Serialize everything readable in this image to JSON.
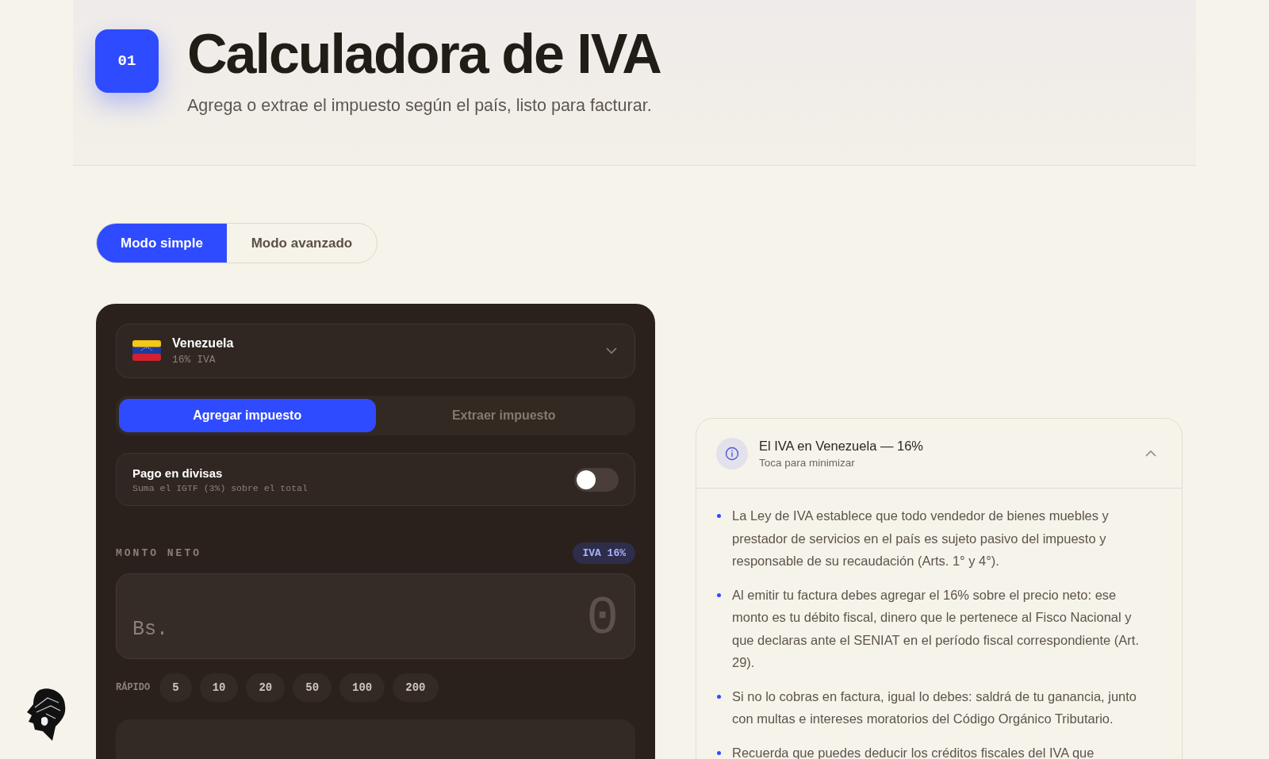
{
  "header": {
    "badge": "01",
    "title": "Calculadora de IVA",
    "subtitle": "Agrega o extrae el impuesto según el país, listo para facturar."
  },
  "modes": [
    {
      "label": "Modo simple",
      "selected": true
    },
    {
      "label": "Modo avanzado",
      "selected": false
    }
  ],
  "calculator": {
    "country": {
      "name": "Venezuela",
      "rate": "16% IVA",
      "expanded": false
    },
    "operations": [
      {
        "label": "Agregar impuesto",
        "selected": true
      },
      {
        "label": "Extraer impuesto",
        "selected": false
      }
    ],
    "currency_payment": {
      "title": "Pago en divisas",
      "description": "Suma el IGTF (3%) sobre el total",
      "on": false
    },
    "amount": {
      "label": "MONTO NETO",
      "badge": "IVA 16%",
      "currency": "Bs.",
      "placeholder": "0"
    },
    "quick": {
      "label": "RÁPIDO",
      "values": [
        "5",
        "10",
        "20",
        "50",
        "100",
        "200"
      ]
    }
  },
  "info": {
    "title": "El IVA en Venezuela — 16%",
    "hint": "Toca para minimizar",
    "expanded": true,
    "bullets": [
      "La Ley de IVA establece que todo vendedor de bienes muebles y prestador de servicios en el país es sujeto pasivo del impuesto y responsable de su recaudación (Arts. 1° y 4°).",
      "Al emitir tu factura debes agregar el 16% sobre el precio neto: ese monto es tu débito fiscal, dinero que le pertenece al Fisco Nacional y que declaras ante el SENIAT en el período fiscal correspondiente (Art. 29).",
      "Si no lo cobras en factura, igual lo debes: saldrá de tu ganancia, junto con multas e intereses moratorios del Código Orgánico Tributario.",
      "Recuerda que puedes deducir los créditos fiscales del IVA que"
    ]
  }
}
